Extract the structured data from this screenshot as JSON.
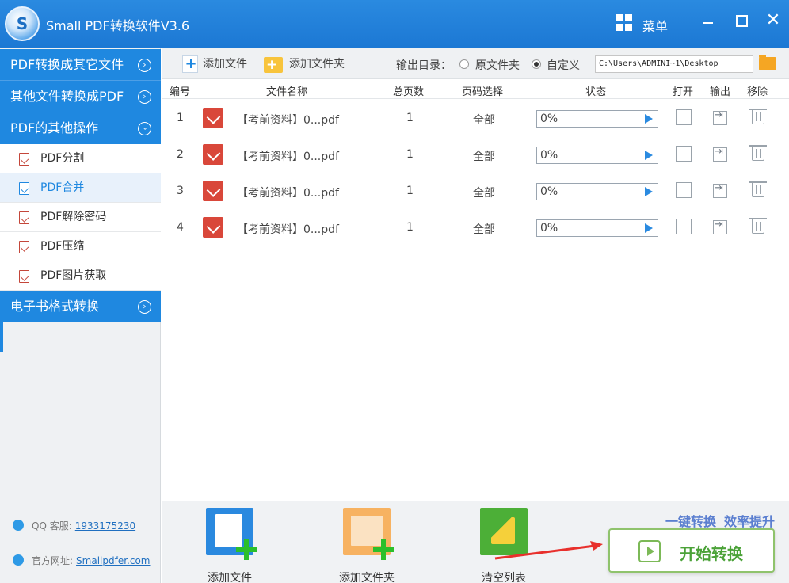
{
  "app": {
    "title": "Small PDF转换软件V3.6",
    "menu_label": "菜单"
  },
  "sidebar": {
    "categories": [
      {
        "label": "PDF转换成其它文件"
      },
      {
        "label": "其他文件转换成PDF"
      },
      {
        "label": "PDF的其他操作"
      },
      {
        "label": "电子书格式转换"
      }
    ],
    "subitems": [
      {
        "label": "PDF分割"
      },
      {
        "label": "PDF合并"
      },
      {
        "label": "PDF解除密码"
      },
      {
        "label": "PDF压缩"
      },
      {
        "label": "PDF图片获取"
      }
    ],
    "active_subitem": "PDF合并",
    "qq_label": "QQ 客服:",
    "qq_number": "1933175230",
    "site_label": "官方网址:",
    "site_url": "Smallpdfer.com"
  },
  "toolbar": {
    "add_file": "添加文件",
    "add_folder": "添加文件夹",
    "output_dir_label": "输出目录：",
    "option_source": "原文件夹",
    "option_custom": "自定义",
    "selected_option": "自定义",
    "output_path": "C:\\Users\\ADMINI~1\\Desktop"
  },
  "table": {
    "headers": {
      "index": "编号",
      "filename": "文件名称",
      "pages": "总页数",
      "range": "页码选择",
      "status": "状态",
      "open": "打开",
      "output": "输出",
      "remove": "移除"
    },
    "rows": [
      {
        "index": "1",
        "filename": "【考前资料】0...pdf",
        "pages": "1",
        "range": "全部",
        "status": "0%",
        "progress": 0
      },
      {
        "index": "2",
        "filename": "【考前资料】0...pdf",
        "pages": "1",
        "range": "全部",
        "status": "0%",
        "progress": 0
      },
      {
        "index": "3",
        "filename": "【考前资料】0...pdf",
        "pages": "1",
        "range": "全部",
        "status": "0%",
        "progress": 0
      },
      {
        "index": "4",
        "filename": "【考前资料】0...pdf",
        "pages": "1",
        "range": "全部",
        "status": "0%",
        "progress": 0
      }
    ]
  },
  "bottom": {
    "add_file": "添加文件",
    "add_folder": "添加文件夹",
    "clear_list": "清空列表",
    "slogan_1": "一键转换",
    "slogan_2": "效率提升",
    "start_button": "开始转换"
  },
  "colors": {
    "primary": "#1f88e0",
    "start_green": "#4ba238",
    "arrow_red": "#e8302c"
  }
}
